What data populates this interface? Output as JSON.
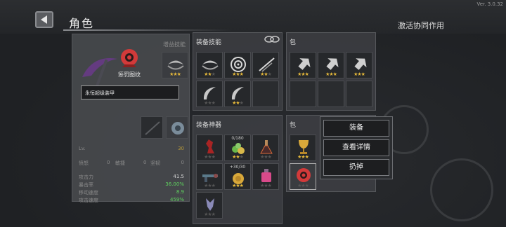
{
  "app": {
    "version": "Ver. 3.0.32",
    "title": "角色",
    "activate_link": "激活协同作用"
  },
  "character": {
    "set_label": "惩罚图纹",
    "tooltip": "永恒超级装甲",
    "gain_title": "增益技能",
    "level_label": "Lv.",
    "level_value": "30",
    "counters": [
      {
        "label": "愤怒",
        "value": "0"
      },
      {
        "label": "敏捷",
        "value": "0"
      },
      {
        "label": "坚韧",
        "value": "0"
      }
    ],
    "stats": [
      {
        "label": "攻击力",
        "value": "41.5",
        "color": "#d6d6d6"
      },
      {
        "label": "暴击率",
        "value": "36.00%",
        "color": "#5fd15f"
      },
      {
        "label": "移动速度",
        "value": "8.9",
        "color": "#5fd15f"
      },
      {
        "label": "攻击速度",
        "value": "459%",
        "color": "#5fd15f"
      }
    ]
  },
  "skills": {
    "title": "装备技能",
    "slots": [
      {
        "icon": "whirl-blade-icon",
        "stars": 3,
        "on": 2
      },
      {
        "icon": "target-ring-icon",
        "stars": 3,
        "on": 3
      },
      {
        "icon": "slash-streak-icon",
        "stars": 3,
        "on": 2
      },
      {
        "icon": "crescent-blade-icon",
        "stars": 3,
        "on": 0
      },
      {
        "icon": "crescent-blade-icon",
        "stars": 3,
        "on": 2
      },
      {
        "icon": "empty-slot",
        "stars": 0,
        "on": 0
      }
    ]
  },
  "skill_bag": {
    "title": "包",
    "slots": [
      {
        "icon": "broken-arrow-icon",
        "stars": 3,
        "on": 3
      },
      {
        "icon": "broken-arrow-icon",
        "stars": 3,
        "on": 3
      },
      {
        "icon": "broken-arrow-icon",
        "stars": 3,
        "on": 3
      }
    ]
  },
  "artifacts": {
    "title": "装备神器",
    "slots": [
      {
        "icon": "red-figure-icon",
        "stars": 3,
        "on": 0,
        "count": ""
      },
      {
        "icon": "gem-cluster-icon",
        "stars": 3,
        "on": 2,
        "count": "0/180"
      },
      {
        "icon": "flask-icon",
        "stars": 3,
        "on": 0,
        "count": ""
      },
      {
        "icon": "claw-gun-icon",
        "stars": 3,
        "on": 0,
        "count": ""
      },
      {
        "icon": "gold-coin-icon",
        "stars": 3,
        "on": 3,
        "count": "+30/30"
      },
      {
        "icon": "pink-potion-icon",
        "stars": 3,
        "on": 0,
        "count": ""
      },
      {
        "icon": "crystal-shard-icon",
        "stars": 3,
        "on": 0,
        "count": ""
      }
    ]
  },
  "artifact_bag": {
    "title": "包",
    "slots": [
      {
        "icon": "chalice-icon",
        "stars": 3,
        "on": 3
      },
      {
        "icon": "red-sigil-icon",
        "stars": 3,
        "on": 0
      }
    ]
  },
  "popup": {
    "equip": "装备",
    "details": "查看详情",
    "discard": "扔掉"
  },
  "colors": {
    "star_on": "#e6b93a",
    "star_off": "#555555",
    "panel": "#3e4044",
    "accent_red": "#d23a3a"
  }
}
